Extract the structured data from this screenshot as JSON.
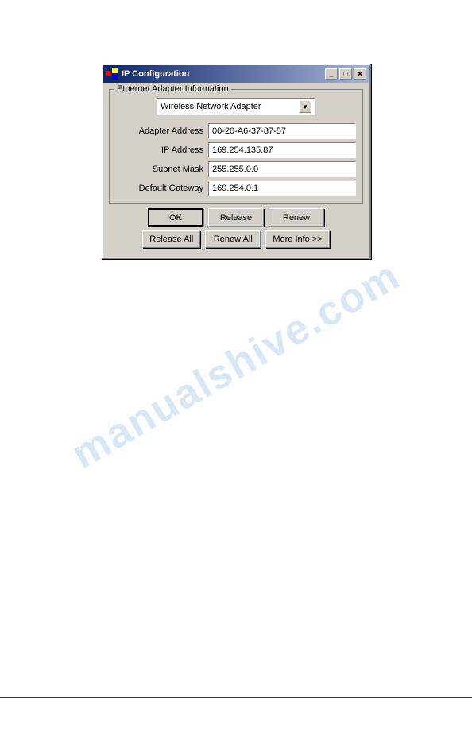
{
  "page": {
    "background": "#ffffff"
  },
  "watermark": {
    "text": "manualshive.com"
  },
  "dialog": {
    "title": "IP Configuration",
    "title_icon": "network-icon",
    "buttons": {
      "minimize": "_",
      "maximize": "□",
      "close": "✕"
    },
    "group_label": "Ethernet  Adapter Information",
    "dropdown": {
      "value": "Wireless Network Adapter",
      "options": [
        "Wireless Network Adapter"
      ]
    },
    "fields": [
      {
        "label": "Adapter Address",
        "value": "00-20-A6-37-87-57"
      },
      {
        "label": "IP Address",
        "value": "169.254.135.87"
      },
      {
        "label": "Subnet Mask",
        "value": "255.255.0.0"
      },
      {
        "label": "Default Gateway",
        "value": "169.254.0.1"
      }
    ],
    "buttons_row1": [
      {
        "id": "ok",
        "label": "OK",
        "default": true
      },
      {
        "id": "release",
        "label": "Release",
        "default": false
      },
      {
        "id": "renew",
        "label": "Renew",
        "default": false
      }
    ],
    "buttons_row2": [
      {
        "id": "release-all",
        "label": "Release All",
        "default": false
      },
      {
        "id": "renew-all",
        "label": "Renew All",
        "default": false
      },
      {
        "id": "more-info",
        "label": "More Info >>",
        "default": false
      }
    ]
  }
}
